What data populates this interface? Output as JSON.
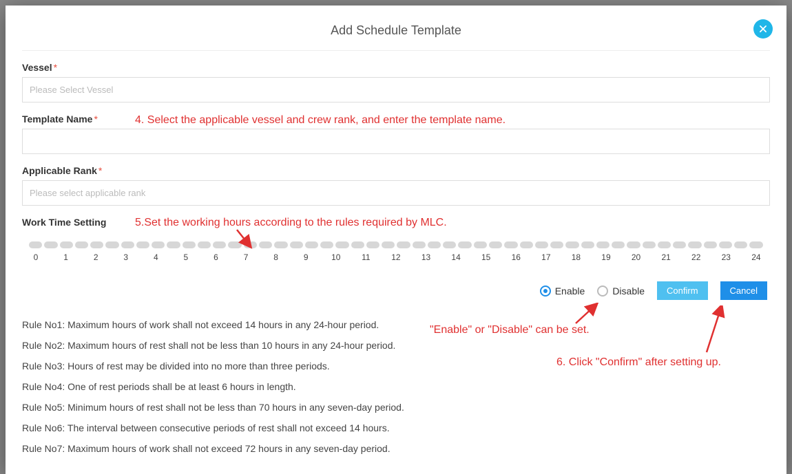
{
  "modal": {
    "title": "Add Schedule Template",
    "close_label": "close"
  },
  "fields": {
    "vessel": {
      "label": "Vessel",
      "placeholder": "Please Select Vessel",
      "required": "*"
    },
    "template_name": {
      "label": "Template Name",
      "placeholder": "",
      "required": "*"
    },
    "applicable_rank": {
      "label": "Applicable Rank",
      "placeholder": "Please select applicable rank",
      "required": "*"
    },
    "work_time": {
      "label": "Work Time Setting"
    }
  },
  "timeline": {
    "segments": 48,
    "hours": [
      "0",
      "1",
      "2",
      "3",
      "4",
      "5",
      "6",
      "7",
      "8",
      "9",
      "10",
      "11",
      "12",
      "13",
      "14",
      "15",
      "16",
      "17",
      "18",
      "19",
      "20",
      "21",
      "22",
      "23",
      "24"
    ]
  },
  "status": {
    "enable_label": "Enable",
    "disable_label": "Disable",
    "selected": "enable"
  },
  "buttons": {
    "confirm": "Confirm",
    "cancel": "Cancel"
  },
  "rules": [
    "Rule No1: Maximum hours of work shall not exceed 14 hours in any 24-hour period.",
    "Rule No2: Maximum hours of rest shall not be less than 10 hours in any 24-hour period.",
    "Rule No3: Hours of rest may be divided into no more than three periods.",
    "Rule No4: One of rest periods shall be at least 6 hours in length.",
    "Rule No5: Minimum hours of rest shall not be less than 70 hours in any seven-day period.",
    "Rule No6: The interval between consecutive periods of rest shall not exceed 14 hours.",
    "Rule No7: Maximum hours of work shall not exceed 72 hours in any seven-day period."
  ],
  "annotations": {
    "step4": "4. Select the applicable vessel and crew rank, and enter the template name.",
    "step5": "5.Set the working hours according to the rules required by MLC.",
    "enable_note": "\"Enable\"   or \"Disable\" can be set.",
    "step6": "6. Click \"Confirm\" after setting up."
  }
}
